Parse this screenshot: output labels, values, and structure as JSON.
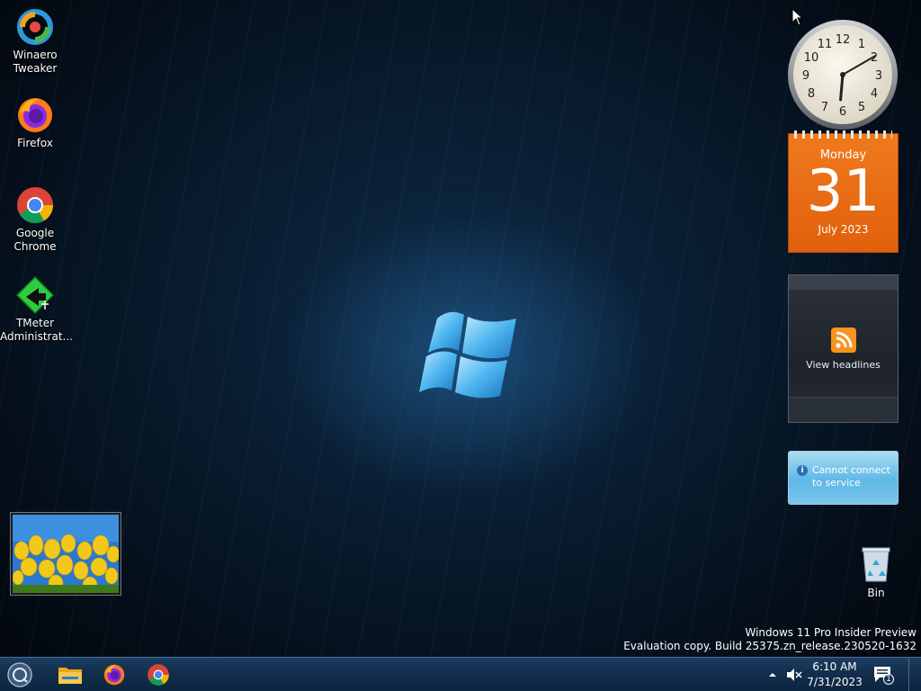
{
  "desktop_icons": [
    {
      "label": "Winaero Tweaker",
      "icon": "winaero-tweaker-icon"
    },
    {
      "label": "Firefox",
      "icon": "firefox-icon"
    },
    {
      "label": "Google Chrome",
      "icon": "chrome-icon"
    },
    {
      "label": "TMeter Administrat...",
      "icon": "tmeter-icon"
    }
  ],
  "calendar": {
    "weekday": "Monday",
    "day": "31",
    "month_year": "July 2023"
  },
  "clock": {
    "hour": 6,
    "minute": 10
  },
  "headlines": {
    "label": "View headlines"
  },
  "weather": {
    "message": "Cannot connect to service"
  },
  "recycle_bin": {
    "label": "Bin"
  },
  "watermark": {
    "line1": "Windows 11 Pro Insider Preview",
    "line2": "Evaluation copy. Build 25375.zn_release.230520-1632"
  },
  "taskbar": {
    "apps": [
      "start-orb-icon",
      "file-explorer-icon",
      "firefox-icon",
      "chrome-icon"
    ],
    "time": "6:10 AM",
    "date": "7/31/2023",
    "notification_count": "1"
  },
  "colors": {
    "calendar_orange": "#e8691a",
    "taskbar_blue": "#13304e",
    "accent_blue": "#2a6fb5"
  }
}
